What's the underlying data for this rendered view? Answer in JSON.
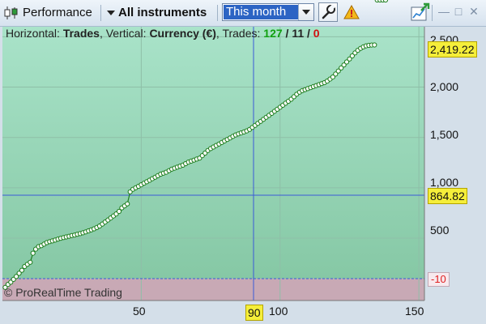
{
  "toolbar": {
    "title": "Performance",
    "instruments": "All instruments",
    "period": "This month"
  },
  "info": {
    "horizontal_label": "Horizontal:",
    "horizontal_value": "Trades",
    "vertical_label": "Vertical:",
    "vertical_value": "Currency (€)",
    "trades_label": "Trades:",
    "trades_win": "127",
    "trades_slash1": " / ",
    "trades_even": "11",
    "trades_slash2": " / ",
    "trades_loss": "0"
  },
  "copyright": "© ProRealTime Trading",
  "axis": {
    "y_ticks": [
      "2,500",
      "2,000",
      "1,500",
      "1,000",
      "500"
    ],
    "x_ticks": [
      "50",
      "100",
      "150"
    ],
    "y_current": "2,419.22",
    "y_cursor": "864.82",
    "y_min_badge": "-10",
    "x_cursor": "90"
  },
  "colors": {
    "plot_top": "#a9e3c9",
    "plot_bottom": "#86c8a5",
    "loss_band": "#c8a9b5",
    "line": "#1d7d1d",
    "marker_fill": "#ffffff",
    "crosshair": "#3a5ad8",
    "badge": "#f5ee3a"
  },
  "chart_data": {
    "type": "line",
    "title": "",
    "xlabel": "Trades",
    "ylabel": "Currency (€)",
    "xlim": [
      0,
      152
    ],
    "ylim": [
      -120,
      2600
    ],
    "x": [
      1,
      2,
      3,
      4,
      5,
      6,
      7,
      8,
      9,
      10,
      11,
      12,
      13,
      14,
      15,
      16,
      17,
      18,
      19,
      20,
      21,
      22,
      23,
      24,
      25,
      26,
      27,
      28,
      29,
      30,
      31,
      32,
      33,
      34,
      35,
      36,
      37,
      38,
      39,
      40,
      41,
      42,
      43,
      44,
      45,
      46,
      47,
      48,
      49,
      50,
      51,
      52,
      53,
      54,
      55,
      56,
      57,
      58,
      59,
      60,
      61,
      62,
      63,
      64,
      65,
      66,
      67,
      68,
      69,
      70,
      71,
      72,
      73,
      74,
      75,
      76,
      77,
      78,
      79,
      80,
      81,
      82,
      83,
      84,
      85,
      86,
      87,
      88,
      89,
      90,
      91,
      92,
      93,
      94,
      95,
      96,
      97,
      98,
      99,
      100,
      101,
      102,
      103,
      104,
      105,
      106,
      107,
      108,
      109,
      110,
      111,
      112,
      113,
      114,
      115,
      116,
      117,
      118,
      119,
      120,
      121,
      122,
      123,
      124,
      125,
      126,
      127,
      128,
      129,
      130,
      131,
      132,
      133,
      134,
      135,
      136,
      137,
      138
    ],
    "values": [
      10,
      40,
      62,
      90,
      118,
      150,
      180,
      218,
      240,
      260,
      350,
      390,
      415,
      425,
      440,
      455,
      465,
      472,
      480,
      490,
      498,
      505,
      512,
      518,
      525,
      530,
      538,
      545,
      553,
      562,
      572,
      582,
      592,
      605,
      620,
      640,
      660,
      680,
      700,
      720,
      740,
      765,
      800,
      820,
      840,
      960,
      985,
      1000,
      1015,
      1030,
      1045,
      1060,
      1075,
      1090,
      1105,
      1120,
      1135,
      1145,
      1155,
      1170,
      1185,
      1195,
      1205,
      1215,
      1225,
      1240,
      1255,
      1265,
      1275,
      1285,
      1295,
      1320,
      1345,
      1370,
      1390,
      1405,
      1420,
      1435,
      1450,
      1465,
      1480,
      1495,
      1510,
      1525,
      1535,
      1545,
      1555,
      1565,
      1580,
      1600,
      1620,
      1640,
      1660,
      1680,
      1700,
      1720,
      1740,
      1760,
      1780,
      1800,
      1820,
      1840,
      1860,
      1880,
      1905,
      1930,
      1950,
      1965,
      1975,
      1985,
      1995,
      2005,
      2015,
      2025,
      2035,
      2045,
      2060,
      2080,
      2100,
      2130,
      2160,
      2190,
      2220,
      2250,
      2280,
      2310,
      2340,
      2365,
      2385,
      2400,
      2410,
      2415,
      2418,
      2419
    ]
  }
}
